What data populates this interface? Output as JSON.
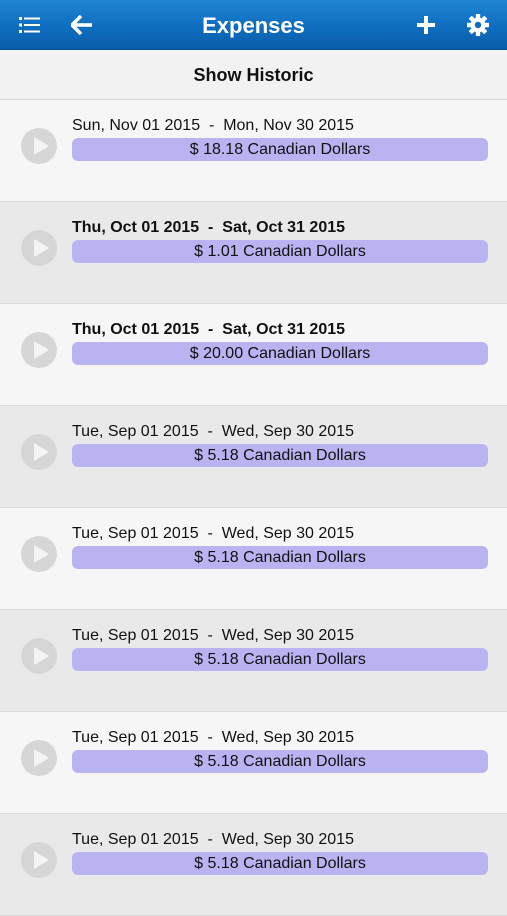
{
  "header": {
    "title": "Expenses",
    "menu_icon": "list-icon",
    "back_icon": "arrow-left-icon",
    "add_icon": "plus-icon",
    "settings_icon": "gear-icon"
  },
  "subheader": {
    "label": "Show Historic"
  },
  "colors": {
    "nav_bar": "#0e6bbd",
    "amount_bar": "#b9b3f2",
    "row_light": "#f6f6f6",
    "row_dark": "#e9e9e9"
  },
  "expenses": [
    {
      "dates": "Sun, Nov 01 2015  -  Mon, Nov 30 2015",
      "amount": "$ 18.18 Canadian Dollars",
      "bold": false
    },
    {
      "dates": "Thu, Oct 01 2015  -  Sat, Oct 31 2015",
      "amount": "$ 1.01 Canadian Dollars",
      "bold": true
    },
    {
      "dates": "Thu, Oct 01 2015  -  Sat, Oct 31 2015",
      "amount": "$ 20.00 Canadian Dollars",
      "bold": true
    },
    {
      "dates": "Tue, Sep 01 2015  -  Wed, Sep 30 2015",
      "amount": "$ 5.18 Canadian Dollars",
      "bold": false
    },
    {
      "dates": "Tue, Sep 01 2015  -  Wed, Sep 30 2015",
      "amount": "$ 5.18 Canadian Dollars",
      "bold": false
    },
    {
      "dates": "Tue, Sep 01 2015  -  Wed, Sep 30 2015",
      "amount": "$ 5.18 Canadian Dollars",
      "bold": false
    },
    {
      "dates": "Tue, Sep 01 2015  -  Wed, Sep 30 2015",
      "amount": "$ 5.18 Canadian Dollars",
      "bold": false
    },
    {
      "dates": "Tue, Sep 01 2015  -  Wed, Sep 30 2015",
      "amount": "$ 5.18 Canadian Dollars",
      "bold": false
    }
  ]
}
